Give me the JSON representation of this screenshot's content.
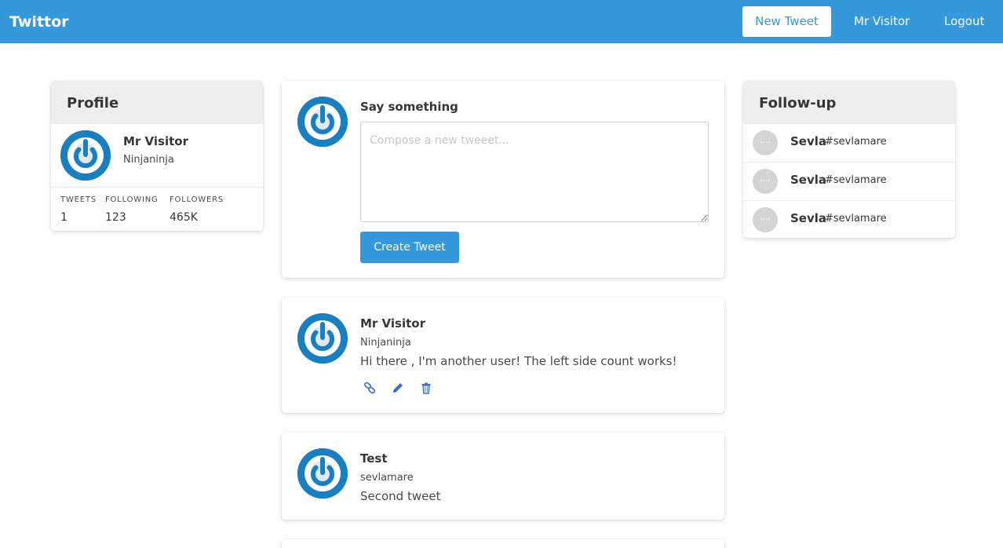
{
  "navbar": {
    "brand": "Twittor",
    "new_tweet_label": "New Tweet",
    "user_label": "Mr Visitor",
    "logout_label": "Logout",
    "color": "#3498db"
  },
  "profile": {
    "header": "Profile",
    "name": "Mr Visitor",
    "handle": "Ninjaninja",
    "stats": [
      {
        "label": "TWEETS",
        "value": "1"
      },
      {
        "label": "FOLLOWING",
        "value": "123"
      },
      {
        "label": "FOLLOWERS",
        "value": "465K"
      }
    ]
  },
  "compose": {
    "title": "Say something",
    "placeholder": "Compose a new tweeet...",
    "button_label": "Create Tweet"
  },
  "tweets": [
    {
      "author": "Mr Visitor",
      "handle": "Ninjaninja",
      "text": "Hi there , I'm another user! The left side count works!",
      "actions": [
        "link-icon",
        "edit-icon",
        "trash-icon"
      ]
    },
    {
      "author": "Test",
      "handle": "sevlamare",
      "text": "Second tweet"
    }
  ],
  "follow_up": {
    "header": "Follow-up",
    "items": [
      {
        "name": "Sevla",
        "tag": "#sevlamare"
      },
      {
        "name": "Sevla",
        "tag": "#sevlamare"
      },
      {
        "name": "Sevla",
        "tag": "#sevlamare"
      }
    ]
  }
}
